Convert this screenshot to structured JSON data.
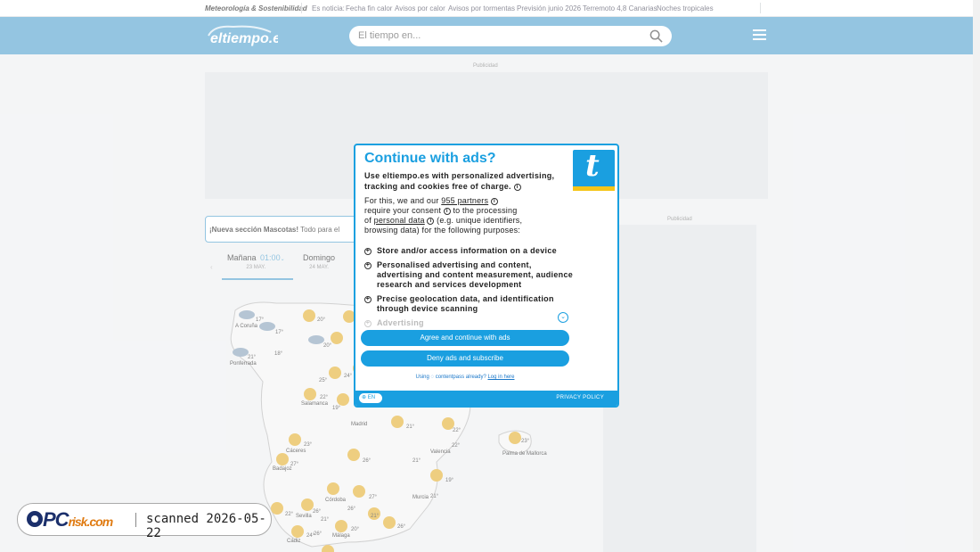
{
  "topbar": {
    "brand": "Meteorología & Sostenibilidad",
    "news_label": "Es noticia:",
    "news": [
      "Fecha fin calor",
      "Avisos por calor",
      "Avisos por tormentas",
      "Previsión junio 2026",
      "Terremoto 4,8 Canarias",
      "Noches tropicales"
    ]
  },
  "header": {
    "logo_text": "eltiempo.es",
    "search_placeholder": "El tiempo en...",
    "bg_color": "#5ba7d2"
  },
  "ads": {
    "label": "Publicidad"
  },
  "mascotas": {
    "bold": "¡Nueva sección Mascotas!",
    "text": "Todo para el"
  },
  "days": [
    {
      "name": "Mañana",
      "time": "01:00",
      "date": "23 MAY."
    },
    {
      "name": "Domingo",
      "date": "24 MAY."
    }
  ],
  "map": {
    "cities": [
      "A Coruña",
      "Ponferrada",
      "Salamanca",
      "Madrid",
      "Cáceres",
      "Badajoz",
      "Valencia",
      "Palma de Mallorca",
      "Murcia",
      "Córdoba",
      "Sevilla",
      "Málaga",
      "Cádiz"
    ],
    "temps": [
      "17°",
      "20°",
      "17°",
      "20°",
      "18°",
      "21°",
      "25°",
      "24°",
      "22°",
      "19°",
      "21°",
      "23°",
      "22°",
      "22°",
      "26°",
      "21°",
      "19°",
      "27°",
      "26°",
      "21°",
      "22°",
      "21°",
      "26°",
      "27°",
      "23°",
      "26°",
      "21°",
      "20°",
      "26°",
      "24°"
    ]
  },
  "modal": {
    "title": "Continue with ads?",
    "lead": "Use eltiempo.es with personalized advertising, tracking and cookies free of charge.",
    "body_1": "For this, we and our",
    "partners_link": "955 partners",
    "body_2": "require your consent",
    "body_3": "to the processing of",
    "personal_data_link": "personal data",
    "body_4": "(e.g. unique identifiers, browsing data) for the following purposes:",
    "purposes": [
      "Store and/or access information on a device",
      "Personalised advertising and content, advertising and content measurement, audience research and services development",
      "Precise geolocation data, and identification through device scanning",
      "Advertising"
    ],
    "agree_button": "Agree and continue with ads",
    "deny_button": "Deny ads and subscribe",
    "contentpass_prefix": "Using",
    "contentpass_name": "contentpass already?",
    "login_link": "Log in here",
    "lang": "EN",
    "privacy": "PRIVACY POLICY",
    "accent": "#1a9fe0",
    "logo_letter": "t"
  },
  "watermark": {
    "logo_main": "PC",
    "logo_suffix": "risk.com",
    "scanned": "scanned 2026-05-22"
  }
}
